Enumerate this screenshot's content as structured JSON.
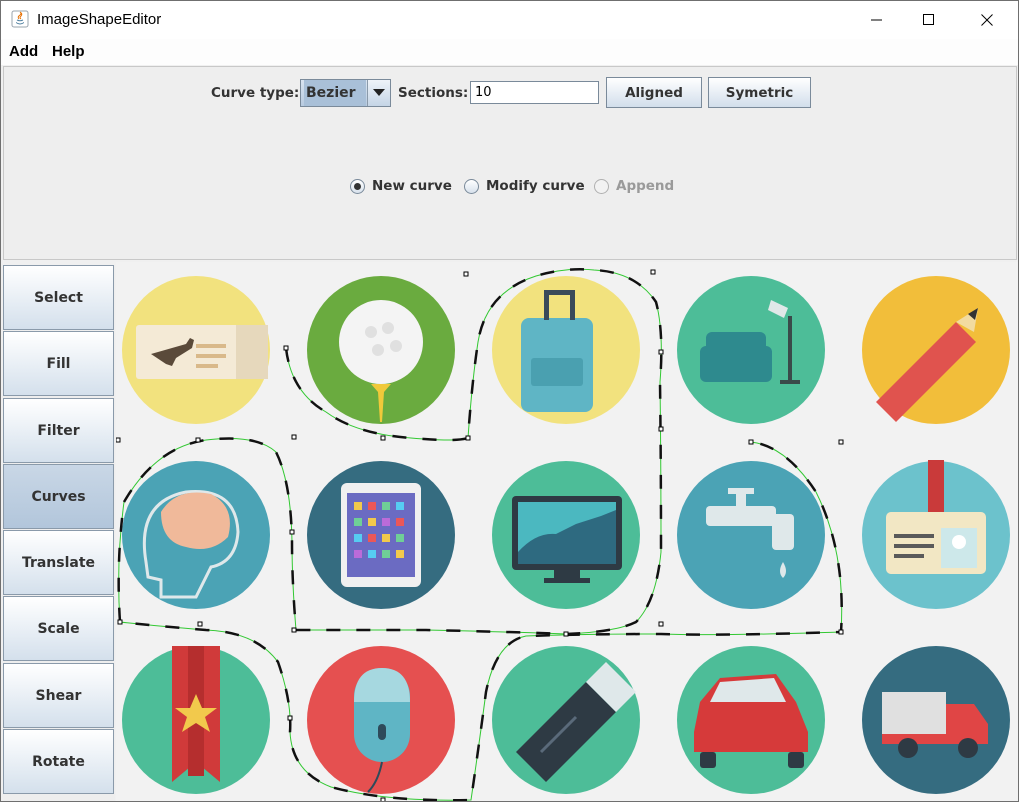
{
  "window": {
    "title": "ImageShapeEditor",
    "icon": "java-icon",
    "controls": [
      "minimize-icon",
      "maximize-icon",
      "close-icon"
    ]
  },
  "menu": {
    "items": [
      {
        "label": "Add"
      },
      {
        "label": "Help"
      }
    ]
  },
  "toolbar": {
    "curve_type_label": "Curve type:",
    "curve_type_value": "Bezier",
    "sections_label": "Sections:",
    "sections_value": "10",
    "aligned_label": "Aligned",
    "symetric_label": "Symetric"
  },
  "mode": {
    "options": [
      {
        "label": "New curve",
        "checked": true,
        "enabled": true
      },
      {
        "label": "Modify curve",
        "checked": false,
        "enabled": true
      },
      {
        "label": "Append",
        "checked": false,
        "enabled": false
      }
    ]
  },
  "tools": {
    "items": [
      {
        "label": "Select"
      },
      {
        "label": "Fill"
      },
      {
        "label": "Filter"
      },
      {
        "label": "Curves",
        "active": true
      },
      {
        "label": "Translate"
      },
      {
        "label": "Scale"
      },
      {
        "label": "Shear"
      },
      {
        "label": "Rotate"
      }
    ]
  },
  "canvas": {
    "icons": [
      "plane-ticket-icon",
      "golf-ball-icon",
      "suitcase-icon",
      "sofa-lamp-icon",
      "pencil-icon",
      "brain-icon",
      "tablet-icon",
      "monitor-chart-icon",
      "faucet-icon",
      "id-badge-icon",
      "ribbon-star-icon",
      "mouse-icon",
      "usb-drive-icon",
      "car-icon",
      "truck-icon"
    ],
    "curve_color": "#32c832"
  }
}
